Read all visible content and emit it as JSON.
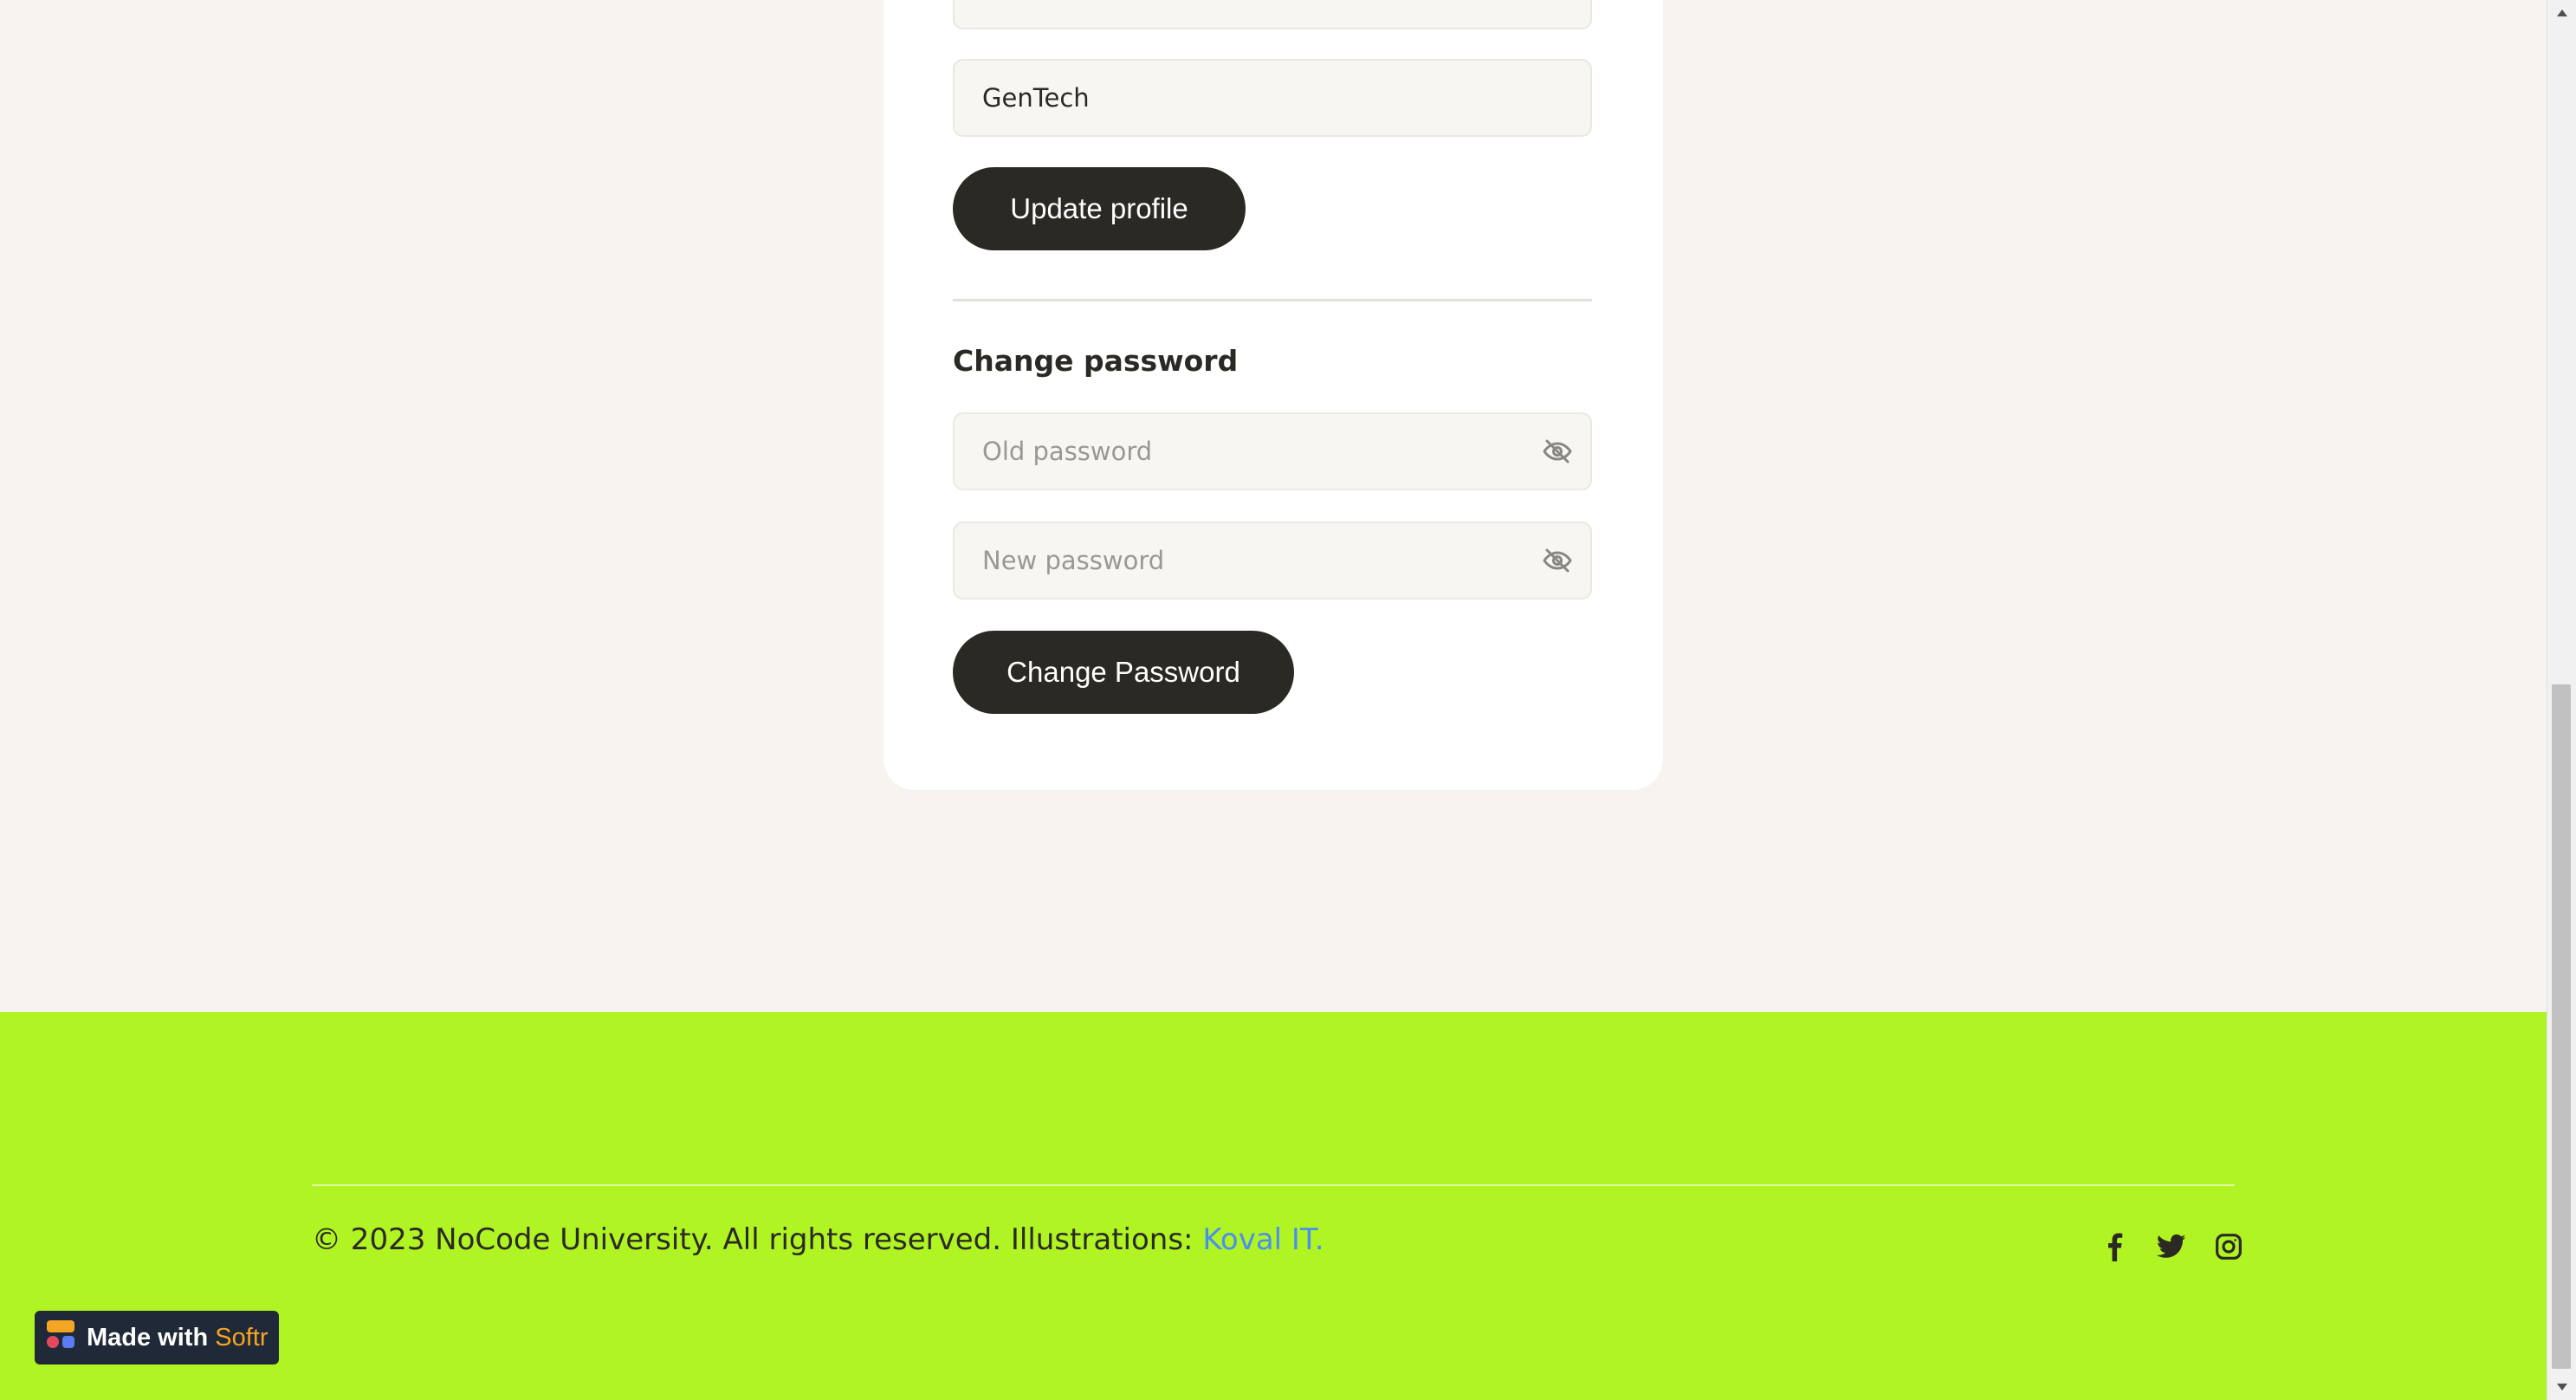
{
  "profile": {
    "company_value": "GenTech",
    "update_button": "Update profile"
  },
  "password": {
    "section_title": "Change password",
    "old_placeholder": "Old password",
    "new_placeholder": "New password",
    "change_button": "Change Password"
  },
  "footer": {
    "copyright_text": "© 2023 NoCode University. All rights reserved. Illustrations: ",
    "illustrations_link": "Koval IT.",
    "socials": [
      "facebook-icon",
      "twitter-icon",
      "instagram-icon"
    ]
  },
  "badge": {
    "made_with": "Made with",
    "brand": "Softr"
  },
  "colors": {
    "page_bg": "#f7f4ef",
    "footer_bg": "#b1f423",
    "button_bg": "#2b2924",
    "link": "#4a8ff0",
    "badge_bg": "#1f2937",
    "badge_brand": "#f5a524"
  }
}
